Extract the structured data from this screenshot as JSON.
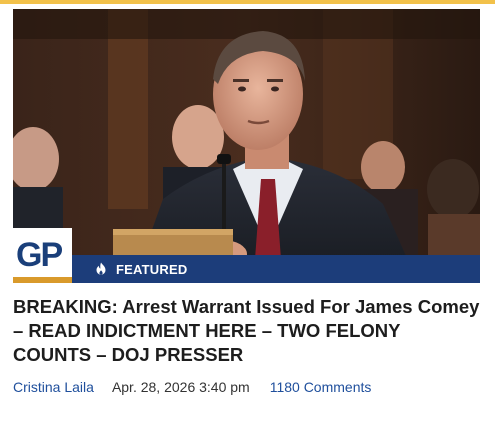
{
  "colors": {
    "accent_top": "#f2c14a",
    "brand_blue": "#1a3f7a",
    "featured_bar": "#1c3d7a",
    "headline": "#1d1d1d",
    "meta_link": "#1f4f9c",
    "logo_stripe": "#d99a2b"
  },
  "logo": {
    "text": "GP",
    "icon": "gp-logo"
  },
  "badge": {
    "icon": "flame-icon",
    "label": "FEATURED"
  },
  "article": {
    "headline": "BREAKING: Arrest Warrant Issued For James Comey – READ INDICTMENT HERE – TWO FELONY COUNTS – DOJ PRESSER",
    "author": "Cristina Laila",
    "date": "Apr. 28, 2026 3:40 pm",
    "comments": "1180 Comments"
  }
}
